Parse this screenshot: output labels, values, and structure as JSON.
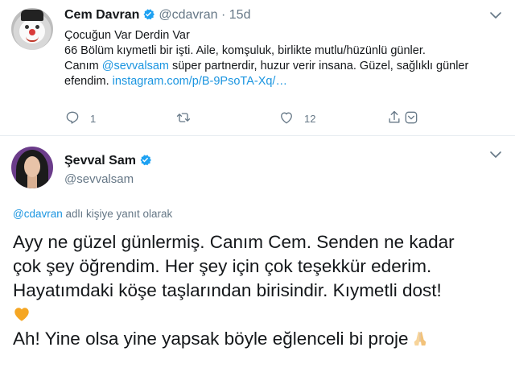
{
  "tweet1": {
    "name": "Cem Davran",
    "handle": "@cdavran",
    "dot": "·",
    "time": "15d",
    "lines": [
      "Çocuğun Var Derdin Var",
      "66 Bölüm kıymetli bir işti. Aile, komşuluk, birlikte mutlu/hüzünlü günler.",
      "super partnerdir, huzur verir insana. Güzel, sağlıklı günler"
    ],
    "line3_prefix": "Canım ",
    "mention": "@sevvalsam",
    "line3_suffix": " süper partnerdir, huzur verir insana. Güzel, sağlıklı günler",
    "line4_prefix": "efendim. ",
    "link": "instagram.com/p/B-9PsoTA-Xq/…",
    "reply_count": "1",
    "retweet_count": "",
    "like_count": "12"
  },
  "tweet2": {
    "name": "Şevval Sam",
    "handle": "@sevvalsam",
    "reply_mention": "@cdavran",
    "reply_text": " adlı kişiye yanıt olarak",
    "lines": [
      "Ayy ne güzel günlermiş. Canım Cem. Senden ne kadar",
      "çok şey öğrendim. Her şey için çok teşekkür ederim.",
      "Hayatımdaki köşe taşlarından birisindir. Kıymetli dost!",
      "Ah! Yine olsa yine yapsak böyle eğlenceli bi proje"
    ]
  },
  "colors": {
    "link": "#1b95e0",
    "verified": "#1da1f2",
    "secondary_text": "#657786",
    "heart_emoji": "#f5a623"
  },
  "icons": [
    "verified-badge-icon",
    "chevron-down-icon",
    "reply-icon",
    "retweet-icon",
    "like-icon",
    "share-icon",
    "yellow-heart-emoji",
    "folded-hands-emoji"
  ]
}
